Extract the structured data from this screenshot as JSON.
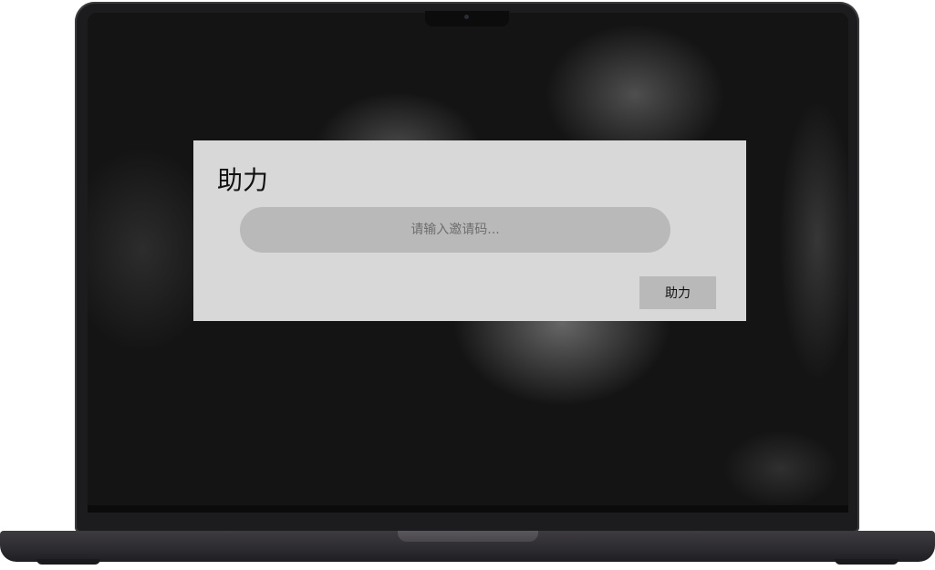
{
  "dialog": {
    "title": "助力",
    "input": {
      "value": "",
      "placeholder": "请输入邀请码..."
    },
    "button_label": "助力"
  }
}
